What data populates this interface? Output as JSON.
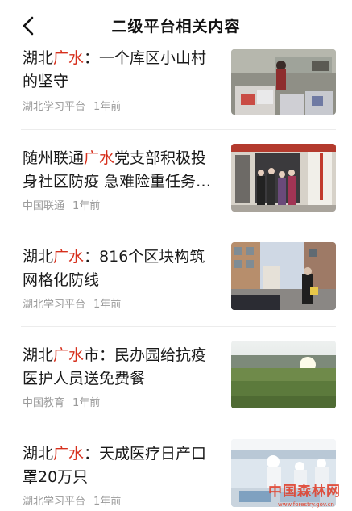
{
  "header": {
    "title": "二级平台相关内容"
  },
  "articles": [
    {
      "prefix": "湖北",
      "highlight": "广水",
      "suffix": "：一个库区小山村的坚守",
      "source": "湖北学习平台",
      "time": "1年前"
    },
    {
      "prefix": "随州联通",
      "highlight": "广水",
      "suffix": "党支部积极投身社区防疫 急难险重任务…",
      "source": "中国联通",
      "time": "1年前"
    },
    {
      "prefix": "湖北",
      "highlight": "广水",
      "suffix": "：816个区块构筑网格化防线",
      "source": "湖北学习平台",
      "time": "1年前"
    },
    {
      "prefix": "湖北",
      "highlight": "广水",
      "suffix": "市：民办园给抗疫医护人员送免费餐",
      "source": "中国教育",
      "time": "1年前"
    },
    {
      "prefix": "湖北",
      "highlight": "广水",
      "suffix": "：天成医疗日产口罩20万只",
      "source": "湖北学习平台",
      "time": "1年前"
    }
  ],
  "watermark": {
    "text": "中国森林网",
    "sub": "www.forestry.gov.cn"
  },
  "colors": {
    "highlight": "#d6301d",
    "meta": "#9b9b9b",
    "divider": "#ececec"
  },
  "icons": {
    "back": "chevron-left-icon"
  }
}
